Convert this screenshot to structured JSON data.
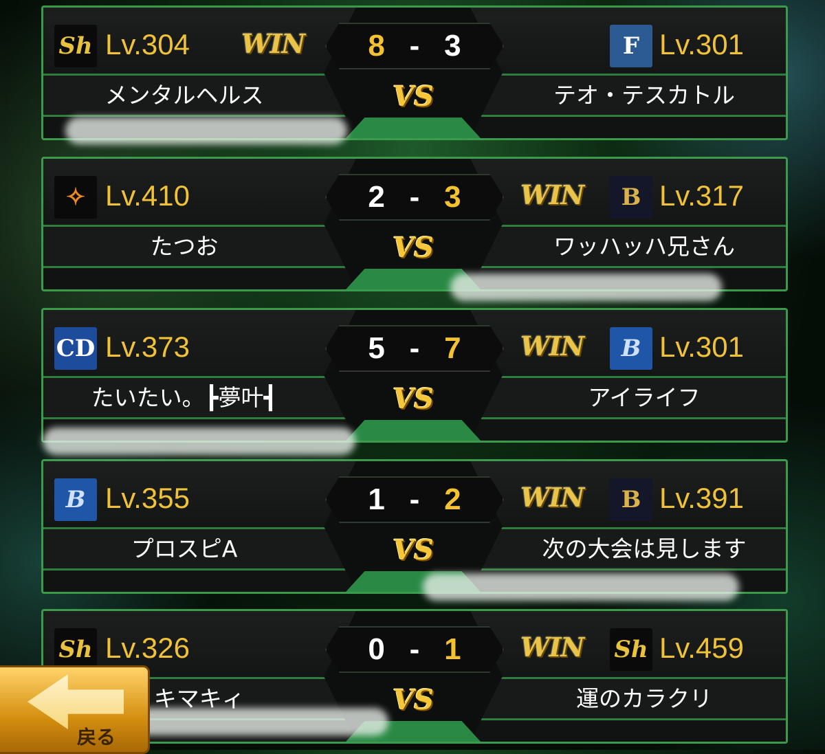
{
  "matches": [
    {
      "left": {
        "team_logo": "SH",
        "level": "Lv.304",
        "name": "メンタルヘルス"
      },
      "right": {
        "team_logo": "F",
        "level": "Lv.301",
        "name": "テオ・テスカトル"
      },
      "score_left": "8",
      "score_right": "3",
      "winner": "left"
    },
    {
      "left": {
        "team_logo": "YG",
        "level": "Lv.410",
        "name": "たつお"
      },
      "right": {
        "team_logo": "B",
        "level": "Lv.317",
        "name": "ワッハッハ兄さん"
      },
      "score_left": "2",
      "score_right": "3",
      "winner": "right"
    },
    {
      "left": {
        "team_logo": "CD",
        "level": "Lv.373",
        "name": "たいたい。┣夢叶┫"
      },
      "right": {
        "team_logo": "DB",
        "level": "Lv.301",
        "name": "アイライフ"
      },
      "score_left": "5",
      "score_right": "7",
      "winner": "right"
    },
    {
      "left": {
        "team_logo": "DB",
        "level": "Lv.355",
        "name": "プロスピA"
      },
      "right": {
        "team_logo": "B",
        "level": "Lv.391",
        "name": "次の大会は見します"
      },
      "score_left": "1",
      "score_right": "2",
      "winner": "right"
    },
    {
      "left": {
        "team_logo": "SH",
        "level": "Lv.326",
        "name": "神 キマキィ"
      },
      "right": {
        "team_logo": "SH",
        "level": "Lv.459",
        "name": "運のカラクリ"
      },
      "score_left": "0",
      "score_right": "1",
      "winner": "right"
    }
  ],
  "labels": {
    "win": "WIN",
    "vs": "VS",
    "dash": "-"
  },
  "back_button": {
    "label": "戻る"
  },
  "colors": {
    "win_score": "#f2c232",
    "level": "#f0c23a",
    "frame": "#3c9a4c"
  }
}
